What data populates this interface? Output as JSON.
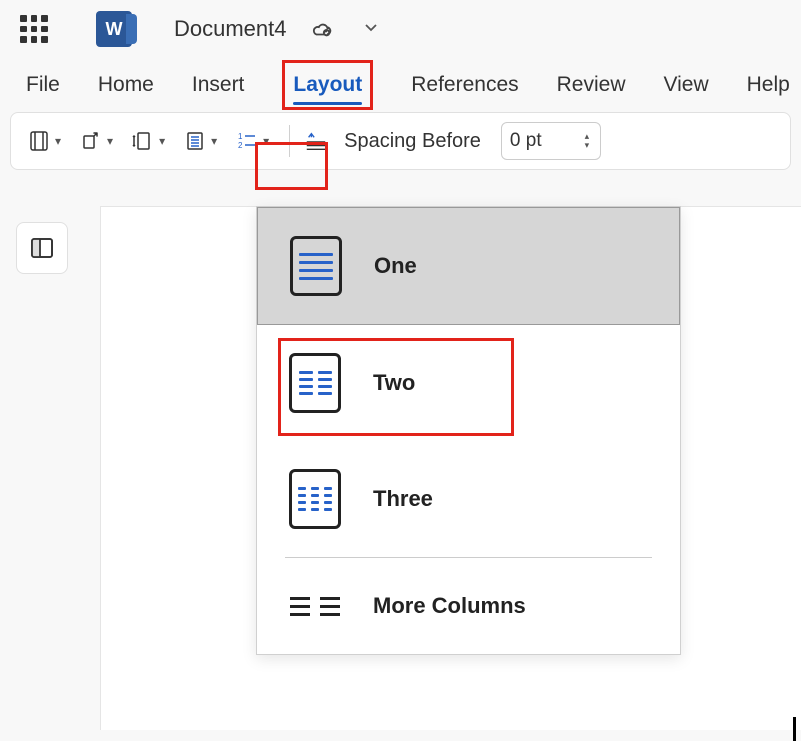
{
  "app": {
    "logo_letter": "W",
    "document_name": "Document4"
  },
  "tabs": {
    "file": "File",
    "home": "Home",
    "insert": "Insert",
    "layout": "Layout",
    "references": "References",
    "review": "Review",
    "view": "View",
    "help": "Help",
    "active": "layout"
  },
  "toolbar": {
    "spacing_before_label": "Spacing Before",
    "spacing_before_value": "0 pt"
  },
  "columns_menu": {
    "one": "One",
    "two": "Two",
    "three": "Three",
    "more": "More Columns",
    "selected": "one"
  }
}
